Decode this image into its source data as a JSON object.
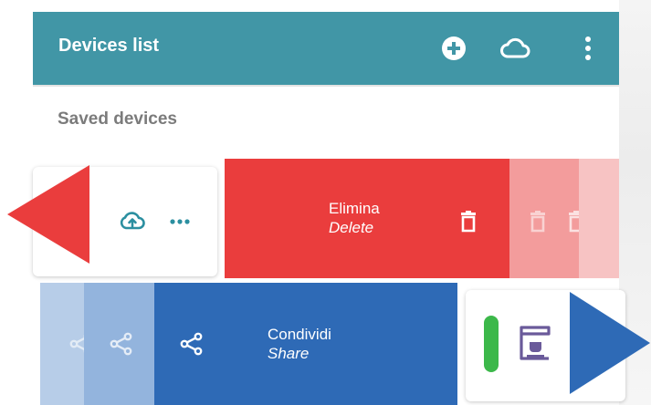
{
  "app_bar": {
    "title": "Devices list",
    "icons": [
      "add-circle-icon",
      "cloud-outline-icon",
      "more-vertical-icon"
    ]
  },
  "section": {
    "label": "Saved devices"
  },
  "delete_action": {
    "label_it": "Elimina",
    "label_en": "Delete"
  },
  "share_action": {
    "label_it": "Condividi",
    "label_en": "Share"
  },
  "colors": {
    "app_bar": "#4196a6",
    "delete": "#ea3d3d",
    "share": "#2e6ab6",
    "status_green": "#3cb84a",
    "device_icon": "#6a5a9a"
  }
}
